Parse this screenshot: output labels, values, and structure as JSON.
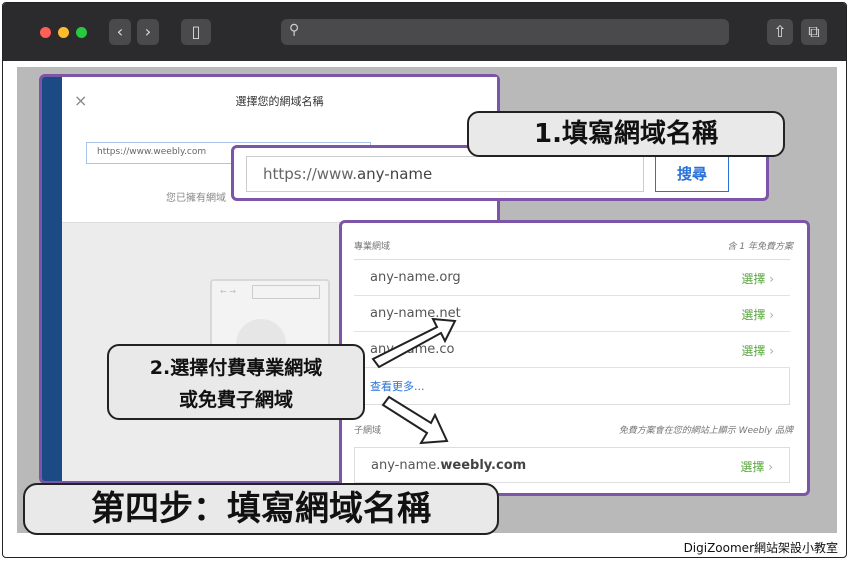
{
  "browser": {
    "traffic_colors": [
      "#ff5f57",
      "#febc2e",
      "#28c840"
    ],
    "icons": [
      "back-icon",
      "forward-icon",
      "sidebar-icon",
      "search-icon",
      "share-icon",
      "tabs-icon"
    ]
  },
  "dialog": {
    "title": "選擇您的網域名稱",
    "url_input": "https://www.weebly.com",
    "own_domain_text": "您已擁有網域"
  },
  "search_bar": {
    "input_prefix": "https://www.",
    "input_bold": "any-name",
    "button_label": "搜尋"
  },
  "domains": {
    "pro_header": "專業網域",
    "pro_note": "含 1 年免費方案",
    "items": [
      {
        "name": "any-name.org",
        "action": "選擇"
      },
      {
        "name": "any-name.net",
        "action": "選擇"
      },
      {
        "name": "any-name.co",
        "action": "選擇"
      }
    ],
    "more_link": "查看更多...",
    "sub_header": "子網域",
    "sub_note": "免費方案會在您的網站上顯示 Weebly 品牌",
    "sub_item": {
      "prefix": "any-name.",
      "bold": "weebly.com",
      "action": "選擇"
    }
  },
  "callouts": {
    "step1": "1.填寫網域名稱",
    "step2_line1": "2.選擇付費專業網域",
    "step2_line2": "或免費子網域",
    "heading": "第四步：填寫網域名稱"
  },
  "footer": {
    "credit": "DigiZoomer網站架設小教室"
  },
  "colors": {
    "accent_purple": "#7c55a8",
    "link_blue": "#2a72d8",
    "select_green": "#5aa83e"
  }
}
